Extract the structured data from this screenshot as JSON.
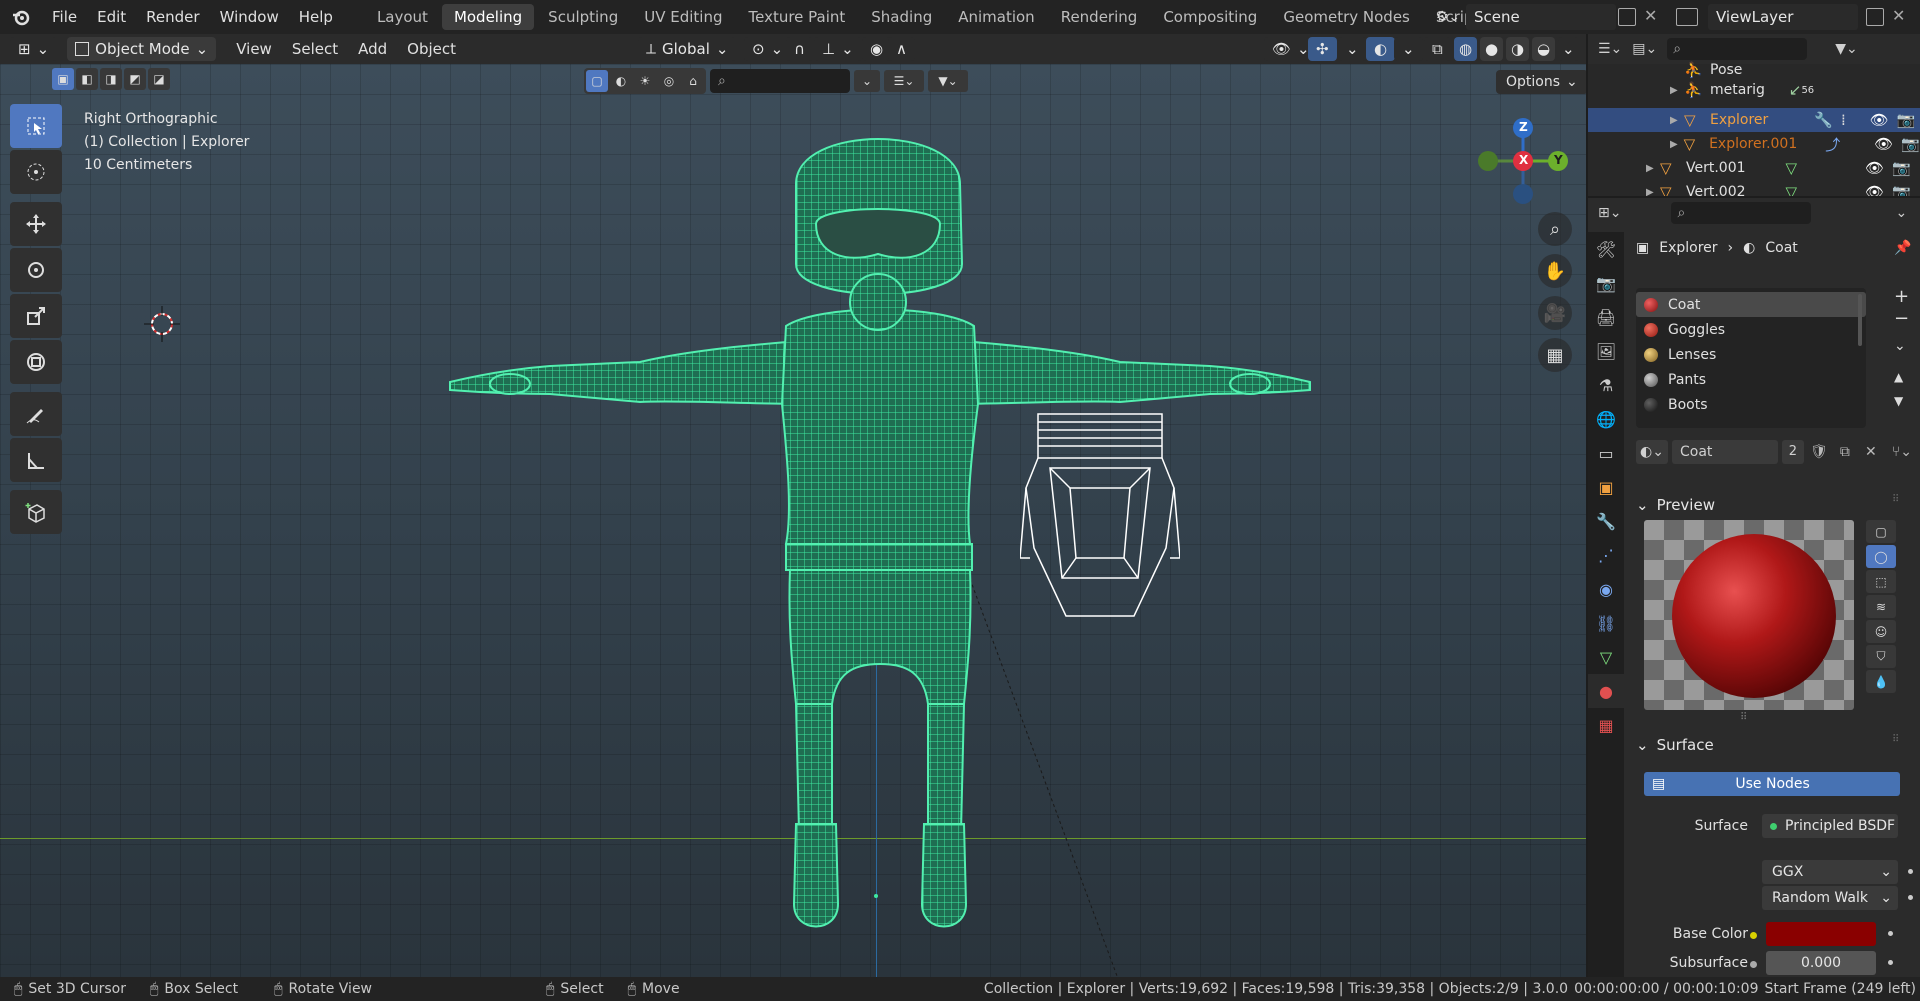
{
  "menu": [
    "File",
    "Edit",
    "Render",
    "Window",
    "Help"
  ],
  "workspaces": [
    "Layout",
    "Modeling",
    "Sculpting",
    "UV Editing",
    "Texture Paint",
    "Shading",
    "Animation",
    "Rendering",
    "Compositing",
    "Geometry Nodes",
    "Scripting"
  ],
  "active_workspace": "Modeling",
  "scene": "Scene",
  "view_layer": "ViewLayer",
  "header": {
    "mode": "Object Mode",
    "view": "View",
    "select": "Select",
    "add": "Add",
    "object": "Object",
    "orientation": "Global",
    "options": "Options"
  },
  "viewport": {
    "view_name": "Right Orthographic",
    "collection_line": "(1) Collection | Explorer",
    "scale": "10 Centimeters",
    "gizmo": {
      "z": "Z",
      "x": "X",
      "y": "Y"
    }
  },
  "outliner": {
    "rows": [
      {
        "label": "Pose",
        "badge": ""
      },
      {
        "label": "metarig",
        "badge": "56"
      },
      {
        "label": "Explorer",
        "badge": ""
      },
      {
        "label": "Explorer.001",
        "badge": ""
      },
      {
        "label": "Vert.001",
        "badge": ""
      },
      {
        "label": "Vert.002",
        "badge": ""
      }
    ]
  },
  "properties": {
    "breadcrumb_object": "Explorer",
    "breadcrumb_material": "Coat",
    "slots": [
      {
        "name": "Coat",
        "color": "#b02020"
      },
      {
        "name": "Goggles",
        "color": "#c03020"
      },
      {
        "name": "Lenses",
        "color": "#c8a040"
      },
      {
        "name": "Pants",
        "color": "#909090"
      },
      {
        "name": "Boots",
        "color": "#202020"
      }
    ],
    "material_name": "Coat",
    "user_count": "2",
    "preview_label": "Preview",
    "surface_label": "Surface",
    "use_nodes": "Use Nodes",
    "surface_field_label": "Surface",
    "surface_value": "Principled BSDF",
    "distribution": "GGX",
    "subsurface_method": "Random Walk",
    "base_color_label": "Base Color",
    "base_color": "#8a0000",
    "subsurface_label": "Subsurface",
    "subsurface_value": "0.000"
  },
  "status": {
    "cursor": "Set 3D Cursor",
    "box": "Box Select",
    "rotate": "Rotate View",
    "select": "Select",
    "move": "Move",
    "stats": "Collection | Explorer | Verts:19,692 | Faces:19,598 | Tris:39,358 | Objects:2/9 | 3.0.0",
    "time": "00:00:00:00 / 00:00:10:09",
    "frame": "Start Frame (249 left)"
  },
  "colors": {
    "mesh": "#3ee8a0",
    "accent": "#5078c0",
    "selected_text": "#f0a040"
  }
}
